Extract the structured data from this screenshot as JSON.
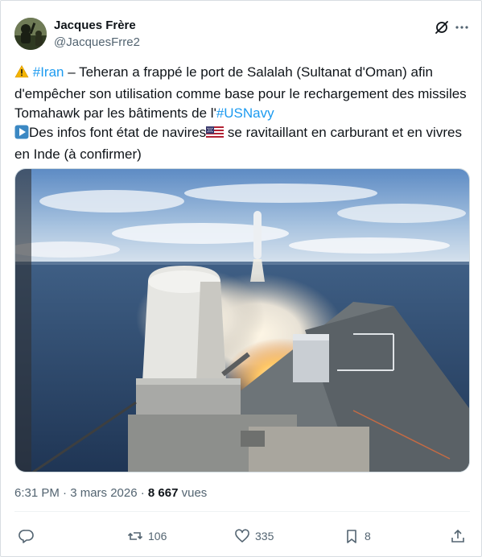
{
  "tweet": {
    "author_name": "Jacques Frère",
    "author_handle": "@JacquesFrre2",
    "line1_prefix": " ",
    "line1_hashtag": "#Iran",
    "line1_rest": " – Teheran a frappé le port de Salalah (Sultanat d'Oman) afin d'empêcher son utilisation comme base pour le rechargement des missiles Tomahawk par les bâtiments de l'",
    "line1_hashtag2": "#USNavy",
    "line2_text": "Des infos font état de navires",
    "line2_rest": " se ravitaillant en carburant et en vivres en Inde (à confirmer)",
    "time": "6:31 PM · 3 mars 2026 · ",
    "views_count": "8 667",
    "views_label": " vues"
  },
  "actions": {
    "reply_count": "",
    "retweet_count": "106",
    "like_count": "335",
    "bookmark_count": "8"
  },
  "icons": {
    "grok": "grok-slash-icon",
    "more": "more-dots-icon",
    "warning": "warning-emoji-icon",
    "play": "play-button-emoji-icon",
    "flag": "us-flag-emoji-icon",
    "reply": "reply-icon",
    "retweet": "retweet-icon",
    "like": "like-heart-icon",
    "bookmark": "bookmark-icon",
    "share": "share-icon"
  },
  "colors": {
    "link": "#1d9bf0",
    "secondary_text": "#536471",
    "primary_text": "#0f1419"
  }
}
